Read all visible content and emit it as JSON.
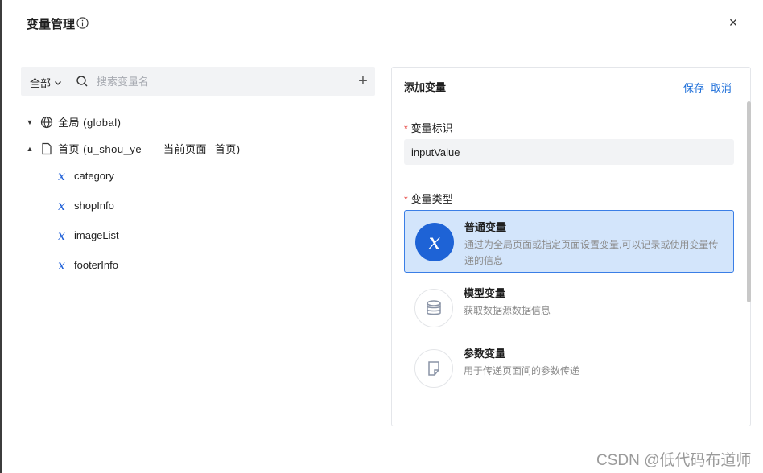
{
  "header": {
    "title": "变量管理",
    "close": "×"
  },
  "toolbar": {
    "scope": "全部",
    "search_placeholder": "搜索变量名",
    "add": "+"
  },
  "tree": {
    "global": {
      "label": "全局 (global)"
    },
    "page": {
      "label": "首页 (u_shou_ye——当前页面--首页)"
    },
    "variables": [
      "category",
      "shopInfo",
      "imageList",
      "footerInfo"
    ]
  },
  "panel": {
    "title": "添加变量",
    "save": "保存",
    "cancel": "取消",
    "id_label": "变量标识",
    "id_value": "inputValue",
    "type_label": "变量类型",
    "required_mark": "*",
    "types": [
      {
        "name": "普通变量",
        "desc": "通过为全局页面或指定页面设置变量,可以记录或使用变量传递的信息",
        "icon": "variable-x-icon",
        "selected": true
      },
      {
        "name": "模型变量",
        "desc": "获取数据源数据信息",
        "icon": "database-icon",
        "selected": false
      },
      {
        "name": "参数变量",
        "desc": "用于传递页面间的参数传递",
        "icon": "page-icon",
        "selected": false
      }
    ]
  },
  "watermark": "CSDN @低代码布道师",
  "colors": {
    "accent": "#1e63d6",
    "selected_bg": "#d3e5fb",
    "link": "#1e6fd9",
    "required": "#e53935"
  }
}
